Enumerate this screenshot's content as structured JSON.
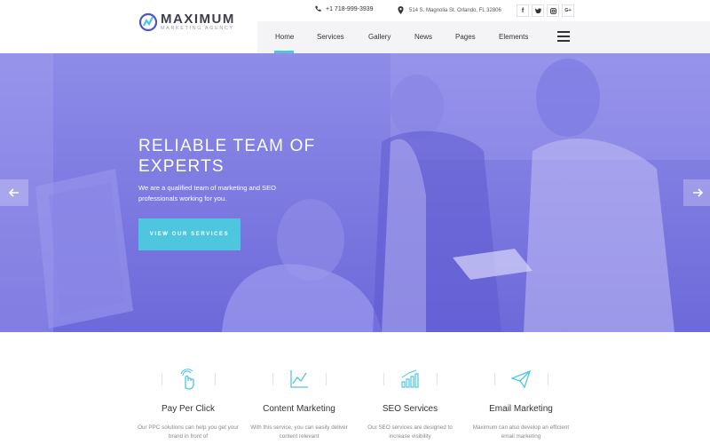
{
  "brand": {
    "name": "MAXIMUM",
    "tagline": "MARKETING AGENCY",
    "logo_icon": "logo-icon"
  },
  "contact": {
    "phone": "+1 718-999-3939",
    "address": "514 S. Magnolia St. Orlando, FL 32806",
    "phone_icon": "phone-icon",
    "address_icon": "location-pin-icon"
  },
  "socials": [
    {
      "label": "f",
      "icon": "facebook-icon"
    },
    {
      "label": "t",
      "icon": "twitter-icon"
    },
    {
      "label": "ig",
      "icon": "instagram-icon"
    },
    {
      "label": "G+",
      "icon": "google-plus-icon"
    }
  ],
  "nav": {
    "items": [
      "Home",
      "Services",
      "Gallery",
      "News",
      "Pages",
      "Elements"
    ],
    "active": "Home",
    "menu_icon": "hamburger-icon"
  },
  "hero": {
    "title": "RELIABLE TEAM OF EXPERTS",
    "text": "We are a qualified team of marketing and SEO professionals working for you.",
    "button": "VIEW OUR SERVICES",
    "prev_icon": "arrow-left-icon",
    "next_icon": "arrow-right-icon"
  },
  "services": [
    {
      "title": "Pay Per Click",
      "desc": "Our PPC solutions can help you get your brand in front of",
      "icon": "tap-hand-icon"
    },
    {
      "title": "Content Marketing",
      "desc": "With this service, you can easily deliver content relevant",
      "icon": "line-chart-icon"
    },
    {
      "title": "SEO Services",
      "desc": "Our SEO services are designed to increase visibility",
      "icon": "bar-chart-icon"
    },
    {
      "title": "Email Marketing",
      "desc": "Maximum can also develop an efficient email marketing",
      "icon": "paper-plane-icon"
    }
  ],
  "colors": {
    "accent": "#4fc6e0",
    "hero_overlay": "#7b78e2",
    "text_dark": "#333333"
  }
}
